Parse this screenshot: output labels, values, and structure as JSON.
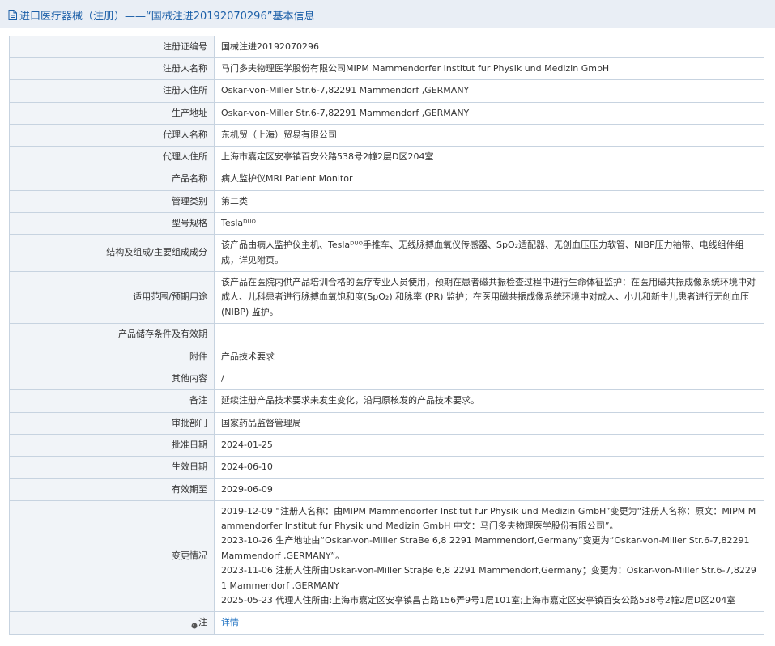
{
  "header": {
    "title": "进口医疗器械（注册）——“国械注进20192070296”基本信息",
    "icon": "document-icon"
  },
  "rows": [
    {
      "label": "注册证编号",
      "value": "国械注进20192070296",
      "height": 27
    },
    {
      "label": "注册人名称",
      "value": "马门多夫物理医学股份有限公司MIPM Mammendorfer Institut fur Physik und Medizin GmbH",
      "height": 27
    },
    {
      "label": "注册人住所",
      "value": "Oskar-von-Miller Str.6-7,82291 Mammendorf ,GERMANY",
      "height": 28
    },
    {
      "label": "生产地址",
      "value": "Oskar-von-Miller Str.6-7,82291 Mammendorf ,GERMANY",
      "height": 27
    },
    {
      "label": "代理人名称",
      "value": "东机贸（上海）贸易有限公司",
      "height": 27
    },
    {
      "label": "代理人住所",
      "value": "上海市嘉定区安亭镇百安公路538号2幢2层D区204室",
      "height": 27
    },
    {
      "label": "产品名称",
      "value": "病人监护仪MRI Patient Monitor",
      "height": 28
    },
    {
      "label": "管理类别",
      "value": "第二类",
      "height": 27
    },
    {
      "label": "型号规格",
      "value": "Teslaᴰᵁᴼ",
      "height": 27
    },
    {
      "label": "结构及组成/主要组成成分",
      "value": "该产品由病人监护仪主机、Teslaᴰᵁᴼ手推车、无线脉搏血氧仪传感器、SpO₂适配器、无创血压压力软管、NIBP压力袖带、电线组件组成，详见附页。",
      "height": 46
    },
    {
      "label": "适用范围/预期用途",
      "value": "该产品在医院内供产品培训合格的医疗专业人员使用，预期在患者磁共振检查过程中进行生命体征监护：在医用磁共振成像系统环境中对成人、儿科患者进行脉搏血氧饱和度(SpO₂) 和脉率 (PR) 监护；在医用磁共振成像系统环境中对成人、小儿和新生儿患者进行无创血压(NIBP) 监护。",
      "height": 64
    },
    {
      "label": "产品储存条件及有效期",
      "value": "",
      "height": 28
    },
    {
      "label": "附件",
      "value": "产品技术要求",
      "height": 27
    },
    {
      "label": "其他内容",
      "value": "/",
      "height": 27
    },
    {
      "label": "备注",
      "value": "延续注册产品技术要求未发生变化，沿用原核发的产品技术要求。",
      "height": 28
    },
    {
      "label": "审批部门",
      "value": "国家药品监督管理局",
      "height": 27
    },
    {
      "label": "批准日期",
      "value": "2024-01-25",
      "height": 27
    },
    {
      "label": "生效日期",
      "value": "2024-06-10",
      "height": 28
    },
    {
      "label": "有效期至",
      "value": "2029-06-09",
      "height": 27
    }
  ],
  "change_history": {
    "label": "变更情况",
    "entries": [
      "2019-12-09 “注册人名称：由MIPM Mammendorfer Institut fur Physik und Medizin GmbH”变更为“注册人名称：原文：MIPM Mammendorfer Institut fur Physik und Medizin GmbH 中文：马门多夫物理医学股份有限公司”。",
      "2023-10-26 生产地址由“Oskar-von-Miller StraBe 6,8 2291 Mammendorf,Germany”变更为“Oskar-von-Miller Str.6-7,82291 Mammendorf ,GERMANY”。",
      "2023-11-06 注册人住所由Oskar-von-Miller Straβe 6,8 2291 Mammendorf,Germany；变更为：Oskar-von-Miller Str.6-7,82291 Mammendorf ,GERMANY",
      "2025-05-23 代理人住所由:上海市嘉定区安亭镇昌吉路156弄9号1层101室;上海市嘉定区安亭镇百安公路538号2幢2层D区204室"
    ]
  },
  "note": {
    "label": "注",
    "link_text": "详情",
    "icon": "note-pin-icon"
  },
  "colors": {
    "header_bg": "#e9eef5",
    "title_blue": "#1b5fa8",
    "link_blue": "#1b6fc0",
    "label_bg": "#f1f4f8",
    "border": "#c7d3e0"
  }
}
